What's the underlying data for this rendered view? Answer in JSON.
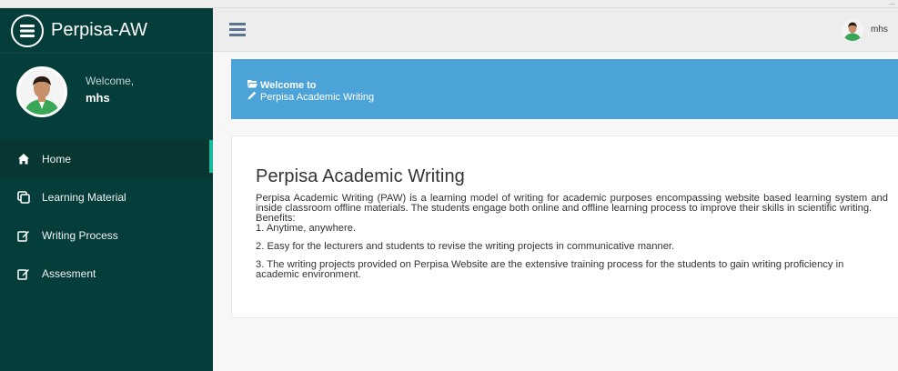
{
  "app": {
    "brand": "Perpisa-AW",
    "top_strip_mark": "—"
  },
  "sidebar": {
    "welcome_label": "Welcome,",
    "username": "mhs",
    "menu": [
      {
        "label": "Home",
        "icon": "home-icon",
        "active": true
      },
      {
        "label": "Learning Material",
        "icon": "clone-icon",
        "active": false
      },
      {
        "label": "Writing Process",
        "icon": "edit-icon",
        "active": false
      },
      {
        "label": "Assesment",
        "icon": "edit-icon",
        "active": false
      }
    ]
  },
  "topbar": {
    "user": "mhs"
  },
  "banner": {
    "line1": "Welcome to",
    "line2": "Perpisa Academic Writing"
  },
  "content": {
    "title": "Perpisa Academic Writing",
    "intro": "Perpisa Academic Writing (PAW) is a learning model of writing for academic purposes encompassing website based learning system and inside classroom offline materials. The students engage both online and offline learning process to improve their skills in scientific writing.",
    "benefits_label": "Benefits:",
    "benefits": [
      "1. Anytime, anywhere.",
      "2. Easy for the lecturers and students to revise the writing projects in communicative manner.",
      "3. The writing projects provided on Perpisa Website are the extensive training process for the students to gain writing proficiency in academic environment."
    ]
  },
  "colors": {
    "sidebar_bg": "#053d3a",
    "banner_bg": "#4ba3d8",
    "active_accent": "#1abb9c"
  }
}
